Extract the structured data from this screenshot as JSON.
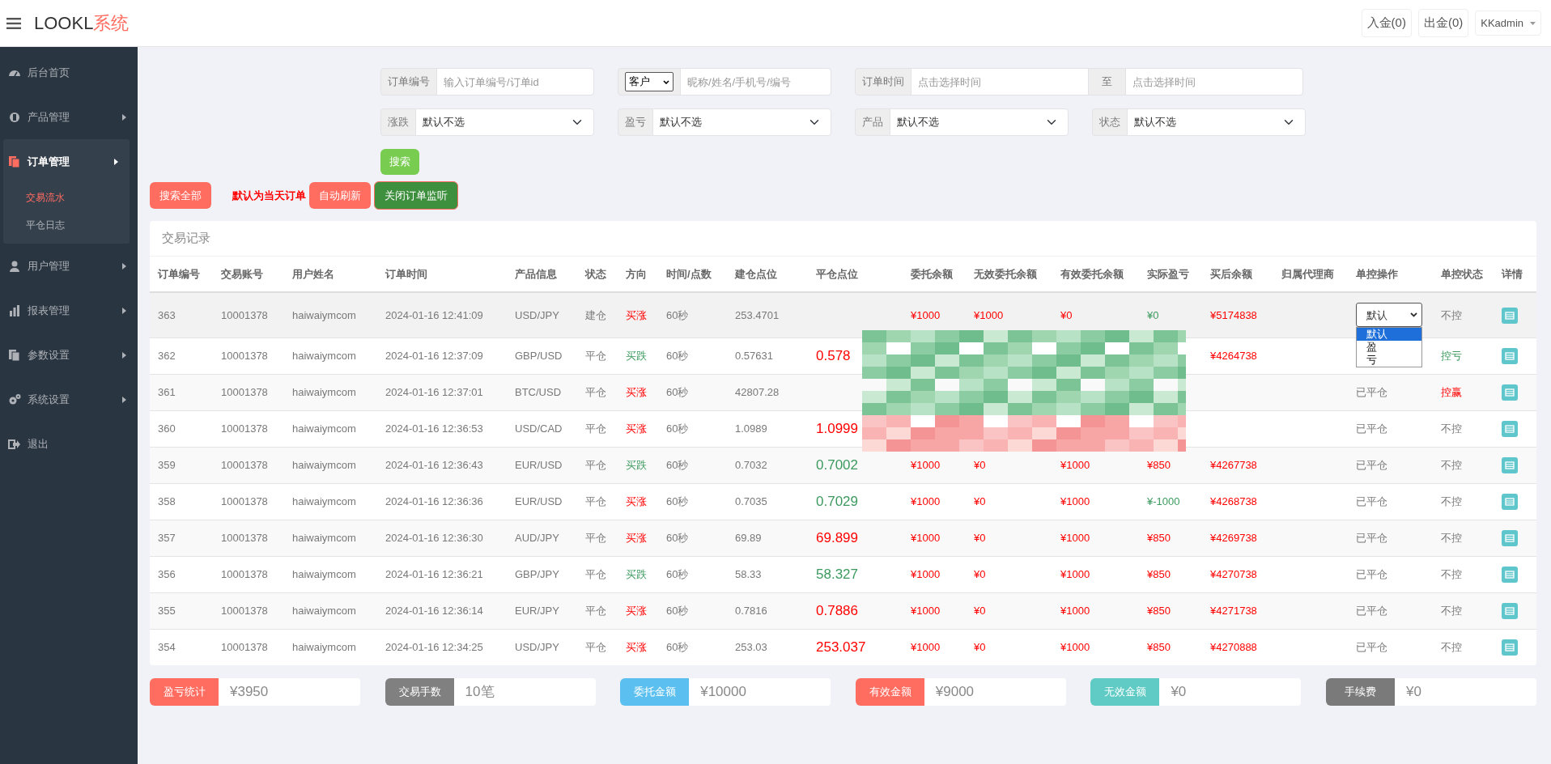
{
  "brand": {
    "name": "LOOKL",
    "suffix": "系统"
  },
  "top_buttons": [
    "入金(0)",
    "出金(0)"
  ],
  "user": "KKadmin",
  "sidebar": {
    "items": [
      {
        "label": "后台首页",
        "has_children": false,
        "expanded": false
      },
      {
        "label": "产品管理",
        "has_children": true,
        "expanded": false
      },
      {
        "label": "订单管理",
        "has_children": true,
        "expanded": true,
        "children": [
          {
            "label": "交易流水",
            "selected": true
          },
          {
            "label": "平仓日志",
            "selected": false
          }
        ]
      },
      {
        "label": "用户管理",
        "has_children": true,
        "expanded": false
      },
      {
        "label": "报表管理",
        "has_children": true,
        "expanded": false
      },
      {
        "label": "参数设置",
        "has_children": true,
        "expanded": false
      },
      {
        "label": "系统设置",
        "has_children": true,
        "expanded": false
      },
      {
        "label": "退出",
        "has_children": false,
        "expanded": false
      }
    ]
  },
  "filters": {
    "order_no": {
      "label": "订单编号",
      "placeholder": "输入订单编号/订单id"
    },
    "customer": {
      "select": "客户",
      "placeholder": "昵称/姓名/手机号/编号"
    },
    "time": {
      "label": "订单时间",
      "placeholder": "点击选择时间",
      "to": "至",
      "placeholder_end": "点击选择时间"
    },
    "selects": [
      {
        "label": "涨跌",
        "value": "默认不选"
      },
      {
        "label": "盈亏",
        "value": "默认不选"
      },
      {
        "label": "产品",
        "value": "默认不选"
      },
      {
        "label": "状态",
        "value": "默认不选"
      }
    ],
    "search": "搜索"
  },
  "actions": {
    "search_all": "搜索全部",
    "note": "默认为当天订单",
    "auto_refresh": "自动刷新",
    "close_monitor": "关闭订单监听"
  },
  "table": {
    "title": "交易记录",
    "columns": [
      "订单编号",
      "交易账号",
      "用户姓名",
      "订单时间",
      "产品信息",
      "状态",
      "方向",
      "时间/点数",
      "建仓点位",
      "平仓点位",
      "委托余额",
      "无效委托余额",
      "有效委托余额",
      "实际盈亏",
      "买后余额",
      "归属代理商",
      "单控操作",
      "单控状态",
      "详情"
    ],
    "rows": [
      {
        "hovered": true,
        "redacted": false,
        "id": "363",
        "account": "10001378",
        "user": "haiwaiymcom",
        "time": "2024-01-16 12:41:09",
        "product": "USD/JPY",
        "state": "建仓",
        "direction": {
          "text": "买涨",
          "up": true
        },
        "duration": "60秒",
        "open": "253.4701",
        "entrust": "¥1000",
        "invalid": "¥1000",
        "valid": "¥0",
        "profit": {
          "text": "¥0",
          "up": false
        },
        "balance": "¥5174838",
        "control": {
          "kind": "select",
          "value": "默认",
          "expanded": true,
          "options": [
            {
              "label": "默认",
              "selected": true
            },
            {
              "label": "盈",
              "selected": false
            },
            {
              "label": "亏",
              "selected": false
            }
          ]
        },
        "control_status": {
          "text": "不控",
          "kind": "none"
        }
      },
      {
        "hovered": false,
        "redacted": true,
        "id": "362",
        "account": "10001378",
        "user": "haiwaiymcom",
        "time": "2024-01-16 12:37:09",
        "product": "GBP/USD",
        "state": "平仓",
        "direction": {
          "text": "买跌",
          "up": false
        },
        "duration": "60秒",
        "open": "0.57631",
        "close": {
          "text": "0.578",
          "up": true
        },
        "balance": "¥4264738",
        "control_status": {
          "text": "控亏",
          "kind": "loss"
        }
      },
      {
        "hovered": false,
        "redacted": false,
        "id": "361",
        "account": "10001378",
        "user": "haiwaiymcom",
        "time": "2024-01-16 12:37:01",
        "product": "BTC/USD",
        "state": "平仓",
        "direction": {
          "text": "买涨",
          "up": true
        },
        "duration": "60秒",
        "open": "42807.28",
        "control": {
          "kind": "text",
          "text": "已平仓"
        },
        "control_status": {
          "text": "控赢",
          "kind": "win"
        }
      },
      {
        "hovered": false,
        "redacted": false,
        "id": "360",
        "account": "10001378",
        "user": "haiwaiymcom",
        "time": "2024-01-16 12:36:53",
        "product": "USD/CAD",
        "state": "平仓",
        "direction": {
          "text": "买涨",
          "up": true
        },
        "duration": "60秒",
        "open": "1.0989",
        "close": {
          "text": "1.0999",
          "up": true
        },
        "control": {
          "kind": "text",
          "text": "已平仓"
        },
        "control_status": {
          "text": "不控",
          "kind": "none"
        }
      },
      {
        "hovered": false,
        "redacted": false,
        "id": "359",
        "account": "10001378",
        "user": "haiwaiymcom",
        "time": "2024-01-16 12:36:43",
        "product": "EUR/USD",
        "state": "平仓",
        "direction": {
          "text": "买跌",
          "up": false
        },
        "duration": "60秒",
        "open": "0.7032",
        "close": {
          "text": "0.7002",
          "up": false
        },
        "entrust": "¥1000",
        "invalid": "¥0",
        "valid": "¥1000",
        "profit": {
          "text": "¥850",
          "up": true
        },
        "balance": "¥4267738",
        "control": {
          "kind": "text",
          "text": "已平仓"
        },
        "control_status": {
          "text": "不控",
          "kind": "none"
        }
      },
      {
        "hovered": false,
        "redacted": false,
        "id": "358",
        "account": "10001378",
        "user": "haiwaiymcom",
        "time": "2024-01-16 12:36:36",
        "product": "EUR/USD",
        "state": "平仓",
        "direction": {
          "text": "买涨",
          "up": true
        },
        "duration": "60秒",
        "open": "0.7035",
        "close": {
          "text": "0.7029",
          "up": false
        },
        "entrust": "¥1000",
        "invalid": "¥0",
        "valid": "¥1000",
        "profit": {
          "text": "¥-1000",
          "up": false
        },
        "balance": "¥4268738",
        "control": {
          "kind": "text",
          "text": "已平仓"
        },
        "control_status": {
          "text": "不控",
          "kind": "none"
        }
      },
      {
        "hovered": false,
        "redacted": false,
        "id": "357",
        "account": "10001378",
        "user": "haiwaiymcom",
        "time": "2024-01-16 12:36:30",
        "product": "AUD/JPY",
        "state": "平仓",
        "direction": {
          "text": "买涨",
          "up": true
        },
        "duration": "60秒",
        "open": "69.89",
        "close": {
          "text": "69.899",
          "up": true
        },
        "entrust": "¥1000",
        "invalid": "¥0",
        "valid": "¥1000",
        "profit": {
          "text": "¥850",
          "up": true
        },
        "balance": "¥4269738",
        "control": {
          "kind": "text",
          "text": "已平仓"
        },
        "control_status": {
          "text": "不控",
          "kind": "none"
        }
      },
      {
        "hovered": false,
        "redacted": false,
        "id": "356",
        "account": "10001378",
        "user": "haiwaiymcom",
        "time": "2024-01-16 12:36:21",
        "product": "GBP/JPY",
        "state": "平仓",
        "direction": {
          "text": "买跌",
          "up": false
        },
        "duration": "60秒",
        "open": "58.33",
        "close": {
          "text": "58.327",
          "up": false
        },
        "entrust": "¥1000",
        "invalid": "¥0",
        "valid": "¥1000",
        "profit": {
          "text": "¥850",
          "up": true
        },
        "balance": "¥4270738",
        "control": {
          "kind": "text",
          "text": "已平仓"
        },
        "control_status": {
          "text": "不控",
          "kind": "none"
        }
      },
      {
        "hovered": false,
        "redacted": false,
        "id": "355",
        "account": "10001378",
        "user": "haiwaiymcom",
        "time": "2024-01-16 12:36:14",
        "product": "EUR/JPY",
        "state": "平仓",
        "direction": {
          "text": "买涨",
          "up": true
        },
        "duration": "60秒",
        "open": "0.7816",
        "close": {
          "text": "0.7886",
          "up": true
        },
        "entrust": "¥1000",
        "invalid": "¥0",
        "valid": "¥1000",
        "profit": {
          "text": "¥850",
          "up": true
        },
        "balance": "¥4271738",
        "control": {
          "kind": "text",
          "text": "已平仓"
        },
        "control_status": {
          "text": "不控",
          "kind": "none"
        }
      },
      {
        "hovered": false,
        "redacted": false,
        "id": "354",
        "account": "10001378",
        "user": "haiwaiymcom",
        "time": "2024-01-16 12:34:25",
        "product": "USD/JPY",
        "state": "平仓",
        "direction": {
          "text": "买涨",
          "up": true
        },
        "duration": "60秒",
        "open": "253.03",
        "close": {
          "text": "253.037",
          "up": true
        },
        "entrust": "¥1000",
        "invalid": "¥0",
        "valid": "¥1000",
        "profit": {
          "text": "¥850",
          "up": true
        },
        "balance": "¥4270888",
        "control": {
          "kind": "text",
          "text": "已平仓"
        },
        "control_status": {
          "text": "不控",
          "kind": "none"
        }
      }
    ]
  },
  "stats": [
    {
      "label": "盈亏统计",
      "value": "¥3950",
      "color": "#ff6c60"
    },
    {
      "label": "交易手数",
      "value": "10笔",
      "color": "#808080"
    },
    {
      "label": "委托金额",
      "value": "¥10000",
      "color": "#5bc0f0"
    },
    {
      "label": "有效金额",
      "value": "¥9000",
      "color": "#ff6c60"
    },
    {
      "label": "无效金额",
      "value": "¥0",
      "color": "#5fcbc4"
    },
    {
      "label": "手续费",
      "value": "¥0",
      "color": "#7a7a7a"
    }
  ]
}
